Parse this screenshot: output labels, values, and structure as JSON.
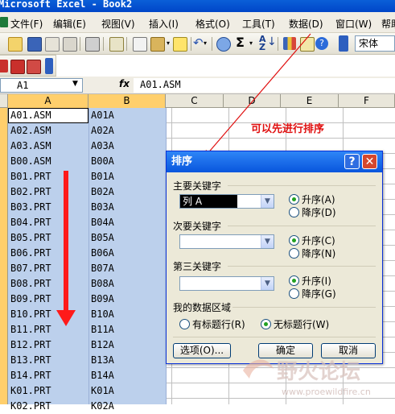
{
  "window": {
    "title": "Microsoft Excel - Book2"
  },
  "menu": [
    "文件(F)",
    "编辑(E)",
    "视图(V)",
    "插入(I)",
    "格式(O)",
    "工具(T)",
    "数据(D)",
    "窗口(W)",
    "帮助"
  ],
  "toolbar": {
    "font_name": "宋体"
  },
  "formula_bar": {
    "name_box": "A1",
    "fx": "fx",
    "content": "A01.ASM"
  },
  "columns": [
    "A",
    "B",
    "C",
    "D",
    "E",
    "F"
  ],
  "rows": [
    [
      "A01.ASM",
      "A01A"
    ],
    [
      "A02.ASM",
      "A02A"
    ],
    [
      "A03.ASM",
      "A03A"
    ],
    [
      "B00.ASM",
      "B00A"
    ],
    [
      "B01.PRT",
      "B01A"
    ],
    [
      "B02.PRT",
      "B02A"
    ],
    [
      "B03.PRT",
      "B03A"
    ],
    [
      "B04.PRT",
      "B04A"
    ],
    [
      "B05.PRT",
      "B05A"
    ],
    [
      "B06.PRT",
      "B06A"
    ],
    [
      "B07.PRT",
      "B07A"
    ],
    [
      "B08.PRT",
      "B08A"
    ],
    [
      "B09.PRT",
      "B09A"
    ],
    [
      "B10.PRT",
      "B10A"
    ],
    [
      "B11.PRT",
      "B11A"
    ],
    [
      "B12.PRT",
      "B12A"
    ],
    [
      "B13.PRT",
      "B13A"
    ],
    [
      "B14.PRT",
      "B14A"
    ],
    [
      "K01.PRT",
      "K01A"
    ],
    [
      "K02.PRT",
      "K02A"
    ]
  ],
  "annotation": "可以先进行排序",
  "dialog": {
    "title": "排序",
    "help": "?",
    "close": "✕",
    "key1": {
      "label": "主要关键字",
      "value": "列 A",
      "asc": "升序(A)",
      "desc": "降序(D)"
    },
    "key2": {
      "label": "次要关键字",
      "value": "",
      "asc": "升序(C)",
      "desc": "降序(N)"
    },
    "key3": {
      "label": "第三关键字",
      "value": "",
      "asc": "升序(I)",
      "desc": "降序(G)"
    },
    "range": {
      "label": "我的数据区域",
      "header_row": "有标题行(R)",
      "no_header_row": "无标题行(W)"
    },
    "buttons": {
      "options": "选项(O)...",
      "ok": "确定",
      "cancel": "取消"
    }
  },
  "watermark": {
    "text": "野火论坛",
    "url": "www.proewildfire.cn"
  },
  "colors": {
    "accent": "#0855dd",
    "annotation": "#e01010",
    "selection": "#bcd0ec",
    "header_selected": "#ffcf6c"
  }
}
